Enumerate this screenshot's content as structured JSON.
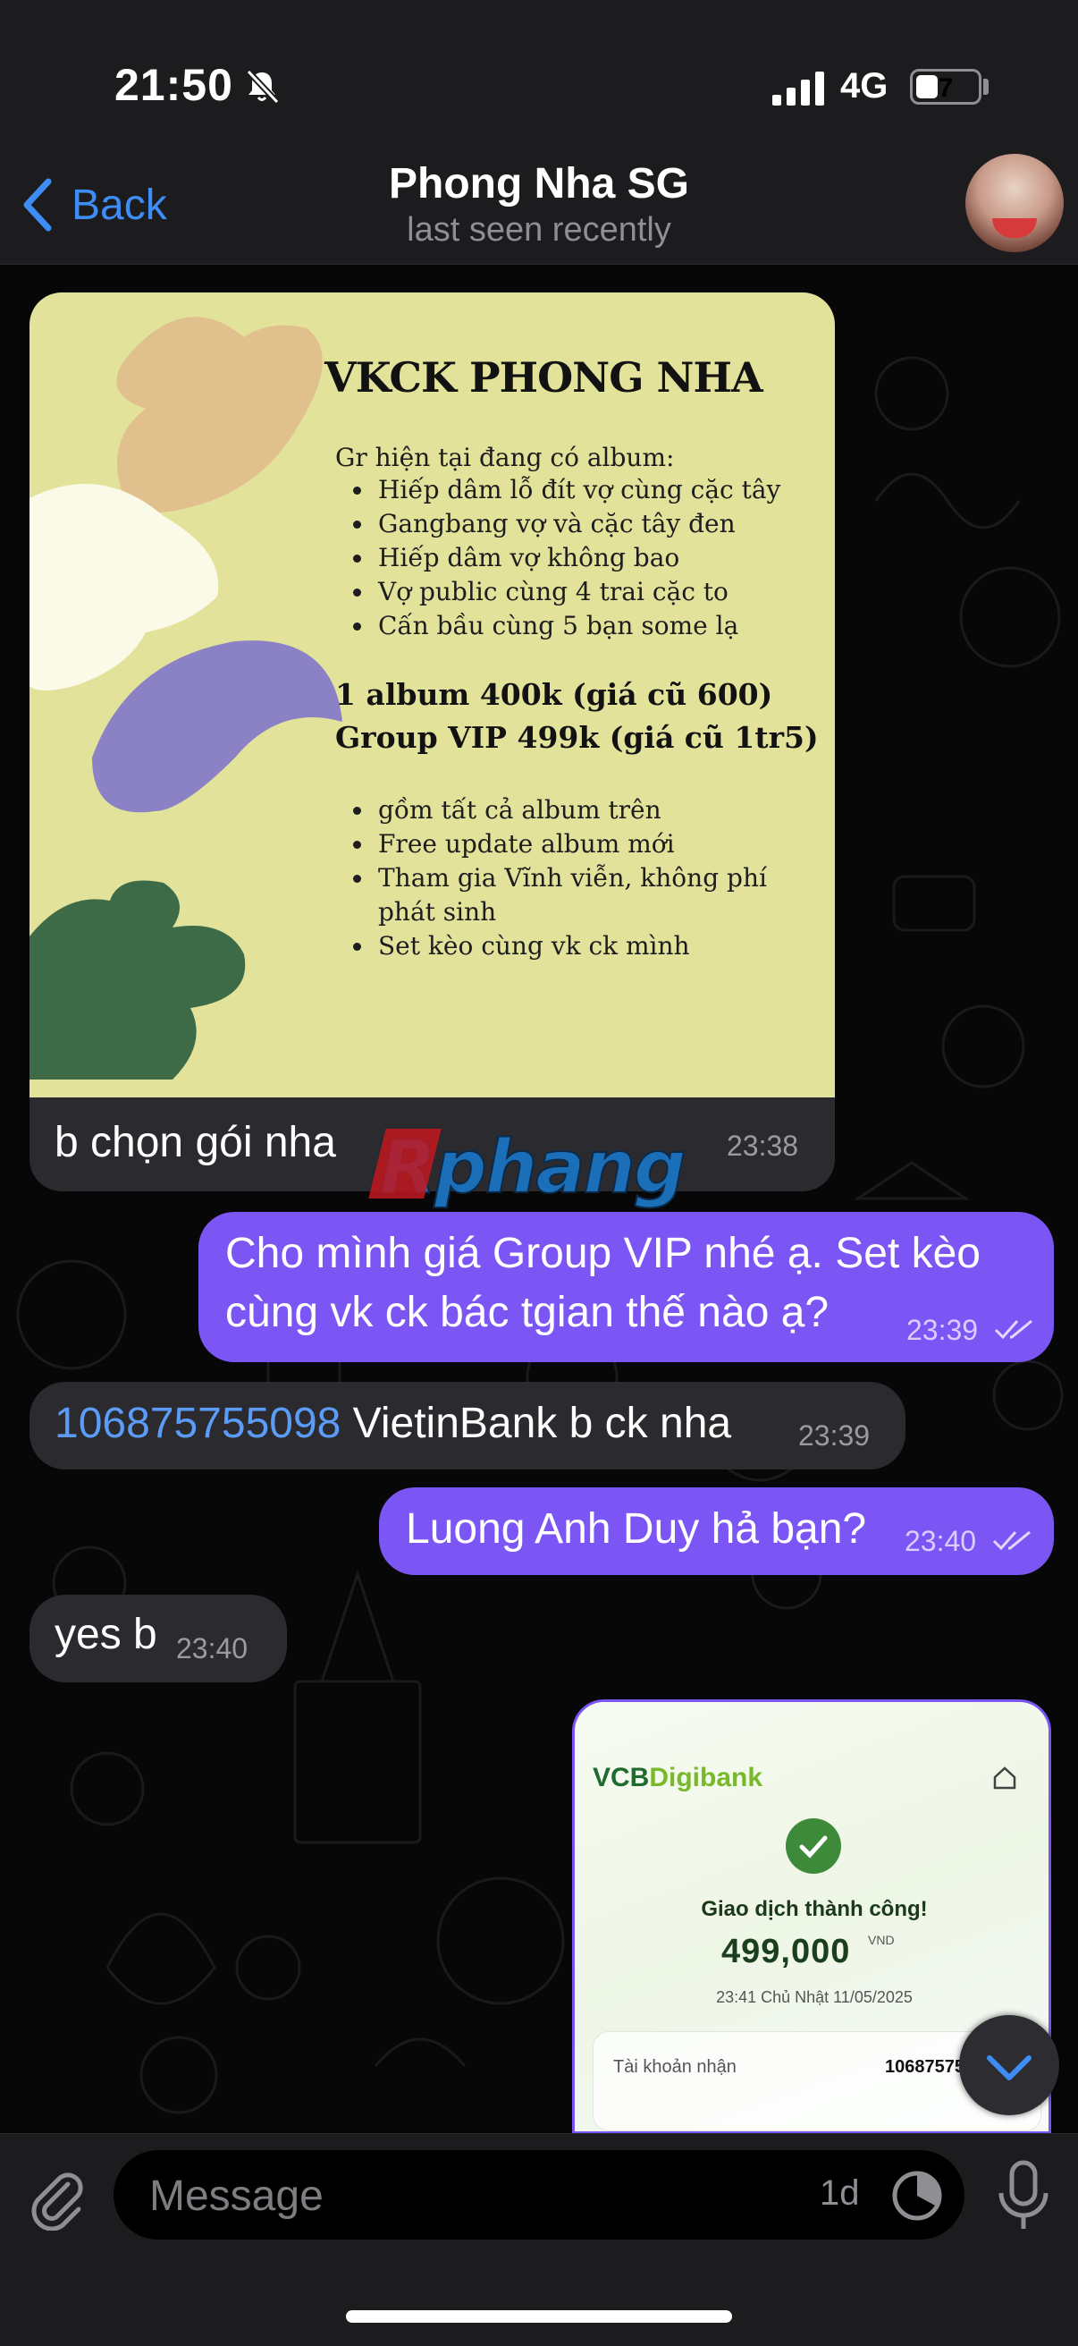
{
  "status_bar": {
    "time": "21:50",
    "network": "4G",
    "battery": "7"
  },
  "nav": {
    "back_label": "Back",
    "title": "Phong Nha SG",
    "subtitle": "last seen recently"
  },
  "poster": {
    "title": "VKCK PHONG NHA",
    "intro": "Gr hiện tại đang có album:",
    "albums": [
      "Hiếp dâm lỗ đít vợ cùng cặc tây",
      "Gangbang vợ và cặc tây đen",
      "Hiếp dâm vợ không bao",
      "Vợ public cùng 4 trai cặc to",
      "Cấn bầu cùng 5 bạn some lạ"
    ],
    "price_album": "1 album 400k (giá cũ 600)",
    "price_vip": "Group VIP 499k (giá cũ 1tr5)",
    "benefits": [
      "gồm tất cả album trên",
      "Free update album mới",
      "Tham gia Vĩnh viễn, không phí",
      "phát sinh",
      "Set kèo cùng vk ck mình"
    ]
  },
  "messages": [
    {
      "text": "b chọn gói nha",
      "time": "23:38"
    },
    {
      "text_line1": "Cho mình giá Group VIP nhé ạ. Set kèo",
      "text_line2": "cùng vk ck bác tgian thế nào ạ?",
      "time": "23:39"
    },
    {
      "link": "106875755098",
      "text": " VietinBank b ck nha",
      "time": "23:39"
    },
    {
      "text": "Luong Anh Duy hả bạn?",
      "time": "23:40"
    },
    {
      "text": "yes b",
      "time": "23:40"
    }
  ],
  "watermark": "Rphang",
  "receipt": {
    "brand_prefix": "VCB",
    "brand_suffix": "Digibank",
    "status": "Giao dịch thành công!",
    "amount": "499,000",
    "currency": "VND",
    "datetime": "23:41 Chủ Nhật 11/05/2025",
    "account_label": "Tài khoản nhận",
    "account_value": "10687575"
  },
  "composer": {
    "placeholder": "Message",
    "timer": "1d"
  },
  "colors": {
    "accent": "#3e8df6",
    "outgoing_bubble": "#7c56f4",
    "incoming_bubble": "#2b2a2e",
    "poster_bg": "#e3e29b"
  }
}
